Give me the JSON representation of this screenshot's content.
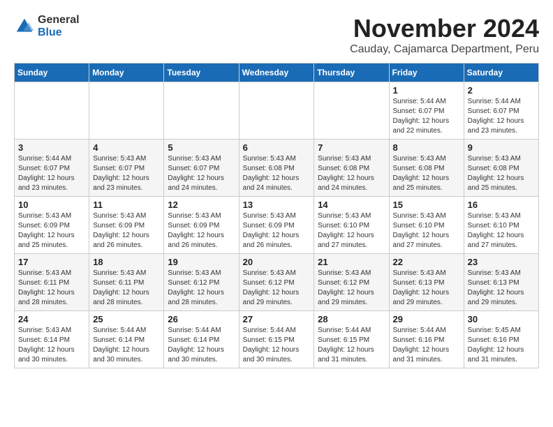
{
  "logo": {
    "general": "General",
    "blue": "Blue"
  },
  "title": "November 2024",
  "subtitle": "Cauday, Cajamarca Department, Peru",
  "headers": [
    "Sunday",
    "Monday",
    "Tuesday",
    "Wednesday",
    "Thursday",
    "Friday",
    "Saturday"
  ],
  "weeks": [
    [
      {
        "day": "",
        "detail": ""
      },
      {
        "day": "",
        "detail": ""
      },
      {
        "day": "",
        "detail": ""
      },
      {
        "day": "",
        "detail": ""
      },
      {
        "day": "",
        "detail": ""
      },
      {
        "day": "1",
        "detail": "Sunrise: 5:44 AM\nSunset: 6:07 PM\nDaylight: 12 hours\nand 22 minutes."
      },
      {
        "day": "2",
        "detail": "Sunrise: 5:44 AM\nSunset: 6:07 PM\nDaylight: 12 hours\nand 23 minutes."
      }
    ],
    [
      {
        "day": "3",
        "detail": "Sunrise: 5:44 AM\nSunset: 6:07 PM\nDaylight: 12 hours\nand 23 minutes."
      },
      {
        "day": "4",
        "detail": "Sunrise: 5:43 AM\nSunset: 6:07 PM\nDaylight: 12 hours\nand 23 minutes."
      },
      {
        "day": "5",
        "detail": "Sunrise: 5:43 AM\nSunset: 6:07 PM\nDaylight: 12 hours\nand 24 minutes."
      },
      {
        "day": "6",
        "detail": "Sunrise: 5:43 AM\nSunset: 6:08 PM\nDaylight: 12 hours\nand 24 minutes."
      },
      {
        "day": "7",
        "detail": "Sunrise: 5:43 AM\nSunset: 6:08 PM\nDaylight: 12 hours\nand 24 minutes."
      },
      {
        "day": "8",
        "detail": "Sunrise: 5:43 AM\nSunset: 6:08 PM\nDaylight: 12 hours\nand 25 minutes."
      },
      {
        "day": "9",
        "detail": "Sunrise: 5:43 AM\nSunset: 6:08 PM\nDaylight: 12 hours\nand 25 minutes."
      }
    ],
    [
      {
        "day": "10",
        "detail": "Sunrise: 5:43 AM\nSunset: 6:09 PM\nDaylight: 12 hours\nand 25 minutes."
      },
      {
        "day": "11",
        "detail": "Sunrise: 5:43 AM\nSunset: 6:09 PM\nDaylight: 12 hours\nand 26 minutes."
      },
      {
        "day": "12",
        "detail": "Sunrise: 5:43 AM\nSunset: 6:09 PM\nDaylight: 12 hours\nand 26 minutes."
      },
      {
        "day": "13",
        "detail": "Sunrise: 5:43 AM\nSunset: 6:09 PM\nDaylight: 12 hours\nand 26 minutes."
      },
      {
        "day": "14",
        "detail": "Sunrise: 5:43 AM\nSunset: 6:10 PM\nDaylight: 12 hours\nand 27 minutes."
      },
      {
        "day": "15",
        "detail": "Sunrise: 5:43 AM\nSunset: 6:10 PM\nDaylight: 12 hours\nand 27 minutes."
      },
      {
        "day": "16",
        "detail": "Sunrise: 5:43 AM\nSunset: 6:10 PM\nDaylight: 12 hours\nand 27 minutes."
      }
    ],
    [
      {
        "day": "17",
        "detail": "Sunrise: 5:43 AM\nSunset: 6:11 PM\nDaylight: 12 hours\nand 28 minutes."
      },
      {
        "day": "18",
        "detail": "Sunrise: 5:43 AM\nSunset: 6:11 PM\nDaylight: 12 hours\nand 28 minutes."
      },
      {
        "day": "19",
        "detail": "Sunrise: 5:43 AM\nSunset: 6:12 PM\nDaylight: 12 hours\nand 28 minutes."
      },
      {
        "day": "20",
        "detail": "Sunrise: 5:43 AM\nSunset: 6:12 PM\nDaylight: 12 hours\nand 29 minutes."
      },
      {
        "day": "21",
        "detail": "Sunrise: 5:43 AM\nSunset: 6:12 PM\nDaylight: 12 hours\nand 29 minutes."
      },
      {
        "day": "22",
        "detail": "Sunrise: 5:43 AM\nSunset: 6:13 PM\nDaylight: 12 hours\nand 29 minutes."
      },
      {
        "day": "23",
        "detail": "Sunrise: 5:43 AM\nSunset: 6:13 PM\nDaylight: 12 hours\nand 29 minutes."
      }
    ],
    [
      {
        "day": "24",
        "detail": "Sunrise: 5:43 AM\nSunset: 6:14 PM\nDaylight: 12 hours\nand 30 minutes."
      },
      {
        "day": "25",
        "detail": "Sunrise: 5:44 AM\nSunset: 6:14 PM\nDaylight: 12 hours\nand 30 minutes."
      },
      {
        "day": "26",
        "detail": "Sunrise: 5:44 AM\nSunset: 6:14 PM\nDaylight: 12 hours\nand 30 minutes."
      },
      {
        "day": "27",
        "detail": "Sunrise: 5:44 AM\nSunset: 6:15 PM\nDaylight: 12 hours\nand 30 minutes."
      },
      {
        "day": "28",
        "detail": "Sunrise: 5:44 AM\nSunset: 6:15 PM\nDaylight: 12 hours\nand 31 minutes."
      },
      {
        "day": "29",
        "detail": "Sunrise: 5:44 AM\nSunset: 6:16 PM\nDaylight: 12 hours\nand 31 minutes."
      },
      {
        "day": "30",
        "detail": "Sunrise: 5:45 AM\nSunset: 6:16 PM\nDaylight: 12 hours\nand 31 minutes."
      }
    ]
  ]
}
